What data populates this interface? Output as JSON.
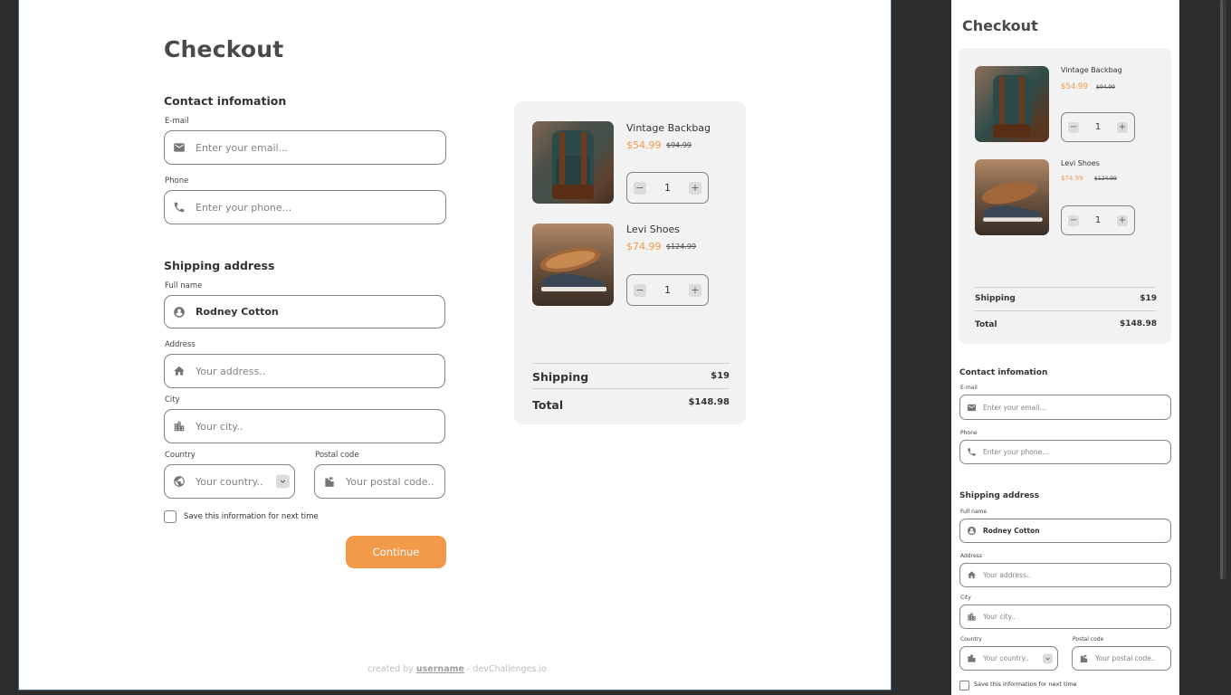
{
  "checkout": {
    "title": "Checkout",
    "contact": {
      "heading": "Contact infomation",
      "email_label": "E-mail",
      "email_placeholder": "Enter your email...",
      "phone_label": "Phone",
      "phone_placeholder": "Enter your phone..."
    },
    "shipping": {
      "heading": "Shipping address",
      "fullname_label": "Full name",
      "fullname_value": "Rodney Cotton",
      "address_label": "Address",
      "address_placeholder": "Your address..",
      "city_label": "City",
      "city_placeholder": "Your city..",
      "country_label": "Country",
      "country_placeholder": "Your country..",
      "postal_label": "Postal code",
      "postal_placeholder": "Your postal code..",
      "save_label": "Save this information for next time"
    },
    "continue_label": "Continue",
    "footer": {
      "prefix": "created by",
      "username": "username",
      "suffix": "- devChallenges.io"
    }
  },
  "cart": {
    "items": [
      {
        "name": "Vintage Backbag",
        "price": "$54.99",
        "old_price": "$94.99",
        "qty": "1",
        "image": "backpack"
      },
      {
        "name": "Levi Shoes",
        "price": "$74.99",
        "old_price": "$124.99",
        "qty": "1",
        "image": "shoes"
      }
    ],
    "shipping_label": "Shipping",
    "shipping_value": "$19",
    "total_label": "Total",
    "total_value": "$148.98"
  },
  "colors": {
    "accent": "#F2994A",
    "panel": "#F2F2F2",
    "border": "#828282",
    "background": "#2C2C2C"
  }
}
